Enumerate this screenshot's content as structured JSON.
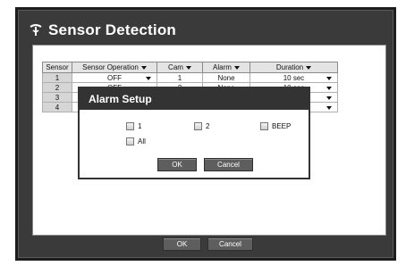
{
  "caption": "(Figure 8)",
  "title": "Sensor Detection",
  "table": {
    "headers": [
      "Sensor",
      "Sensor Operation",
      "Cam",
      "Alarm",
      "Duration"
    ],
    "rows": [
      {
        "sensor": "1",
        "operation": "OFF",
        "cam": "1",
        "alarm": "None",
        "duration": "10 sec"
      },
      {
        "sensor": "2",
        "operation": "OFF",
        "cam": "2",
        "alarm": "None",
        "duration": "10 sec"
      },
      {
        "sensor": "3",
        "operation": "",
        "cam": "",
        "alarm": "",
        "duration": ""
      },
      {
        "sensor": "4",
        "operation": "",
        "cam": "",
        "alarm": "",
        "duration": ""
      }
    ]
  },
  "dialog": {
    "title": "Alarm Setup",
    "options": [
      "1",
      "2",
      "BEEP",
      "All"
    ],
    "ok_label": "OK",
    "cancel_label": "Cancel"
  },
  "footer": {
    "ok_label": "OK",
    "cancel_label": "Cancel"
  }
}
